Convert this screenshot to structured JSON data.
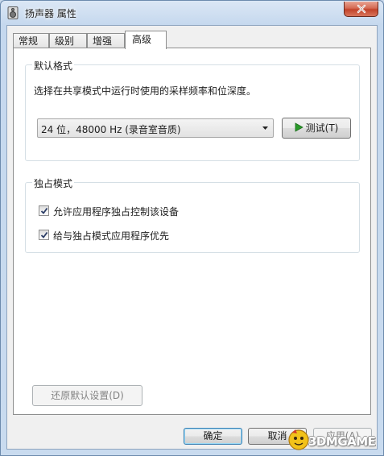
{
  "window": {
    "title": "扬声器 属性",
    "close_icon": "close-icon"
  },
  "tabs": [
    {
      "label": "常规",
      "active": false
    },
    {
      "label": "级别",
      "active": false
    },
    {
      "label": "增强",
      "active": false
    },
    {
      "label": "高级",
      "active": true
    }
  ],
  "default_format": {
    "legend": "默认格式",
    "description": "选择在共享模式中运行时使用的采样频率和位深度。",
    "selected": "24 位，48000 Hz (录音室音质)",
    "test_button": "测试(T)"
  },
  "exclusive_mode": {
    "legend": "独占模式",
    "options": [
      {
        "label": "允许应用程序独占控制该设备",
        "checked": true
      },
      {
        "label": "给与独占模式应用程序优先",
        "checked": true
      }
    ]
  },
  "restore_button": "还原默认设置(D)",
  "dialog_buttons": {
    "ok": "确定",
    "cancel": "取消",
    "apply": "应用(A)"
  },
  "watermark": {
    "text": "3DMGAME"
  },
  "colors": {
    "play_green": "#2a9a2a",
    "title_gradient_top": "#dbe7f5"
  }
}
